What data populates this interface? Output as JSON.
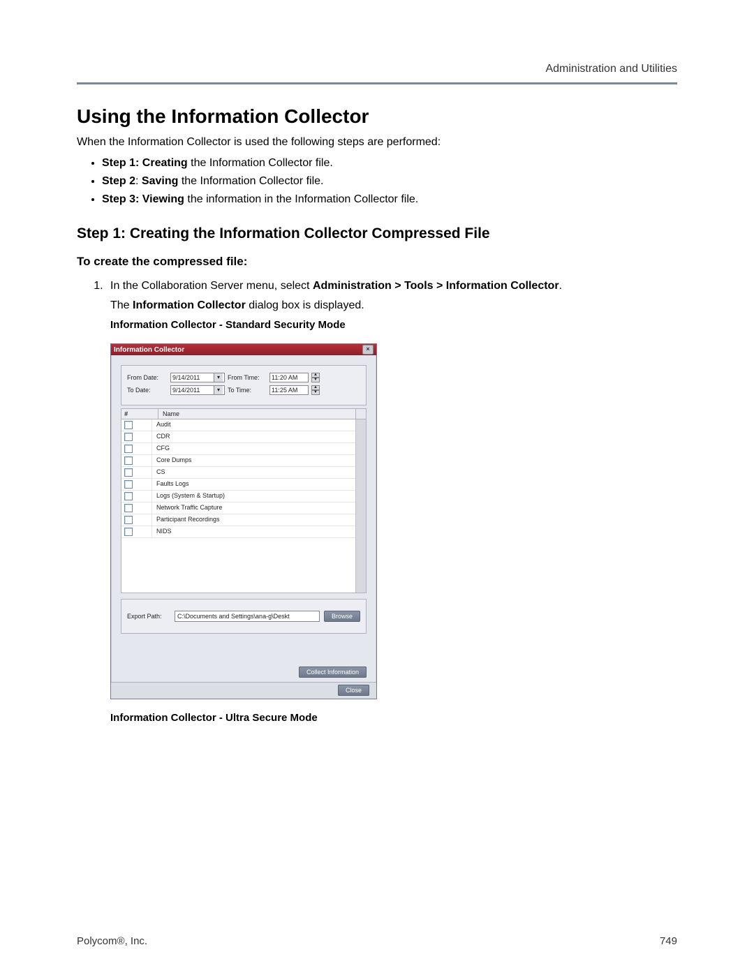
{
  "header": {
    "section": "Administration and Utilities"
  },
  "title": "Using the Information Collector",
  "intro": "When the Information Collector is used the following steps are performed:",
  "bullets": [
    {
      "prefix": "Step 1: Creating",
      "rest": " the Information Collector file."
    },
    {
      "prefix": "Step 2",
      "mid": ": ",
      "bold2": "Saving",
      "rest": " the Information Collector file."
    },
    {
      "prefix": "Step 3: Viewing",
      "rest": " the information in the Information Collector file."
    }
  ],
  "step1_heading": "Step 1: Creating the Information Collector Compressed File",
  "subtask": "To create the compressed file:",
  "proc1": {
    "lead": "In the Collaboration Server menu, select ",
    "bold": "Administration > Tools > Information Collector",
    "tail": "."
  },
  "proc1b": {
    "lead": "The ",
    "bold": "Information Collector",
    "tail": " dialog box is displayed."
  },
  "caption1": "Information Collector - Standard Security Mode",
  "dialog": {
    "title": "Information Collector",
    "from_date_label": "From Date:",
    "to_date_label": "To Date:",
    "from_time_label": "From Time:",
    "to_time_label": "To Time:",
    "from_date": "9/14/2011",
    "to_date": "9/14/2011",
    "from_time": "11:20 AM",
    "to_time": "11:25 AM",
    "col_check": "#",
    "col_name": "Name",
    "items": [
      "Audit",
      "CDR",
      "CFG",
      "Core Dumps",
      "CS",
      "Faults Logs",
      "Logs (System & Startup)",
      "Network Traffic Capture",
      "Participant Recordings",
      "NIDS"
    ],
    "export_label": "Export Path:",
    "export_value": "C:\\Documents and Settings\\ana-g\\Deskt",
    "browse": "Browse",
    "collect": "Collect Information",
    "close": "Close"
  },
  "caption2": "Information Collector - Ultra Secure Mode",
  "footer": {
    "left": "Polycom®, Inc.",
    "right": "749"
  }
}
